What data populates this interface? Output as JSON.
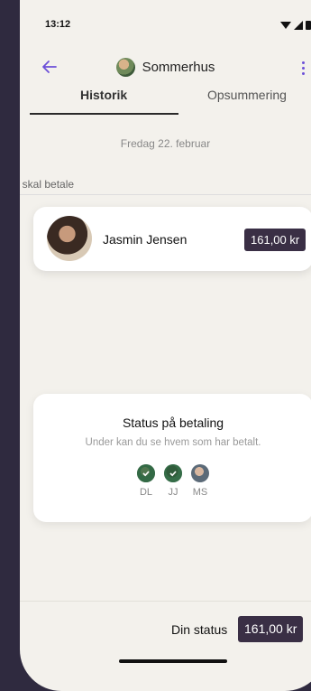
{
  "status_bar": {
    "time": "13:12"
  },
  "header": {
    "title": "Sommerhus"
  },
  "tabs": [
    {
      "label": "Historik"
    },
    {
      "label": "Opsummering"
    }
  ],
  "date": "Fredag 22. februar",
  "section": {
    "label": "Du skal betale"
  },
  "person": {
    "name": "Jasmin Jensen",
    "amount": "161,00 kr"
  },
  "status_card": {
    "title": "Status på betaling",
    "subtitle": "Under kan du se hvem som har betalt.",
    "members": [
      {
        "initials": "DL",
        "paid": true
      },
      {
        "initials": "JJ",
        "paid": true
      },
      {
        "initials": "MS",
        "paid": false
      }
    ]
  },
  "footer": {
    "label": "Din status",
    "amount": "161,00 kr"
  },
  "colors": {
    "accent": "#6b4fd8",
    "badge": "#3a2f45",
    "background": "#f3f1ec"
  }
}
